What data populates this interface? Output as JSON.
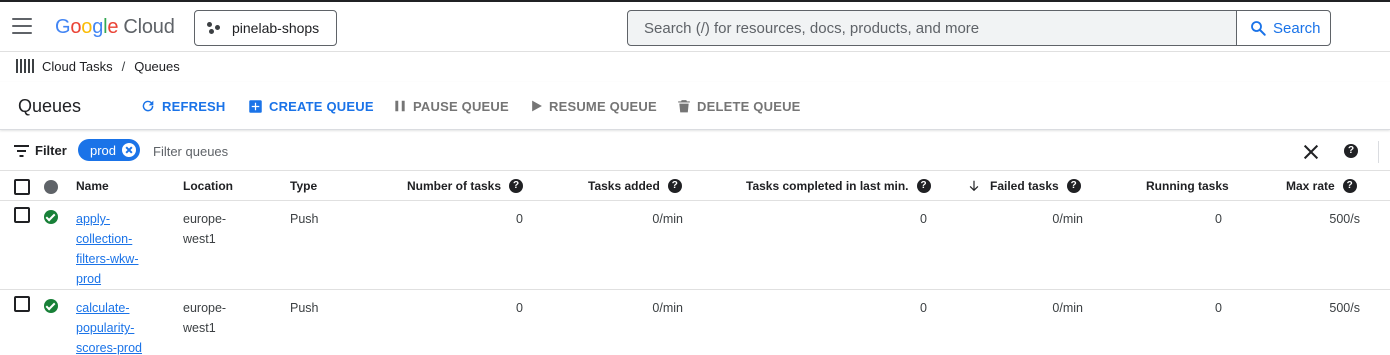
{
  "app": {
    "logo": {
      "google": [
        "G",
        "o",
        "o",
        "g",
        "l",
        "e"
      ],
      "cloud": "Cloud"
    },
    "project": "pinelab-shops",
    "search": {
      "placeholder": "Search (/) for resources, docs, products, and more",
      "button": "Search"
    }
  },
  "breadcrumb": {
    "product": "Cloud Tasks",
    "separator": "/",
    "page": "Queues"
  },
  "toolbar": {
    "title": "Queues",
    "refresh": "REFRESH",
    "create": "CREATE QUEUE",
    "pause": "PAUSE QUEUE",
    "resume": "RESUME QUEUE",
    "delete": "DELETE QUEUE"
  },
  "filter": {
    "label": "Filter",
    "chip": "prod",
    "placeholder": "Filter queues"
  },
  "table": {
    "columns": {
      "name": "Name",
      "location": "Location",
      "type": "Type",
      "number_of_tasks": "Number of tasks",
      "tasks_added": "Tasks added",
      "tasks_completed": "Tasks completed in last min.",
      "failed_tasks": "Failed tasks",
      "running_tasks": "Running tasks",
      "max_rate": "Max rate"
    },
    "rows": [
      {
        "name": "apply-collection-filters-wkw-prod",
        "location": "europe-west1",
        "type": "Push",
        "number_of_tasks": "0",
        "tasks_added": "0/min",
        "tasks_completed": "0",
        "failed_tasks": "0/min",
        "running_tasks": "0",
        "max_rate": "500/s"
      },
      {
        "name": "calculate-popularity-scores-prod",
        "location": "europe-west1",
        "type": "Push",
        "number_of_tasks": "0",
        "tasks_added": "0/min",
        "tasks_completed": "0",
        "failed_tasks": "0/min",
        "running_tasks": "0",
        "max_rate": "500/s"
      }
    ]
  },
  "colors": {
    "accent": "#1a73e8",
    "success": "#188038",
    "disabled": "#757575"
  }
}
